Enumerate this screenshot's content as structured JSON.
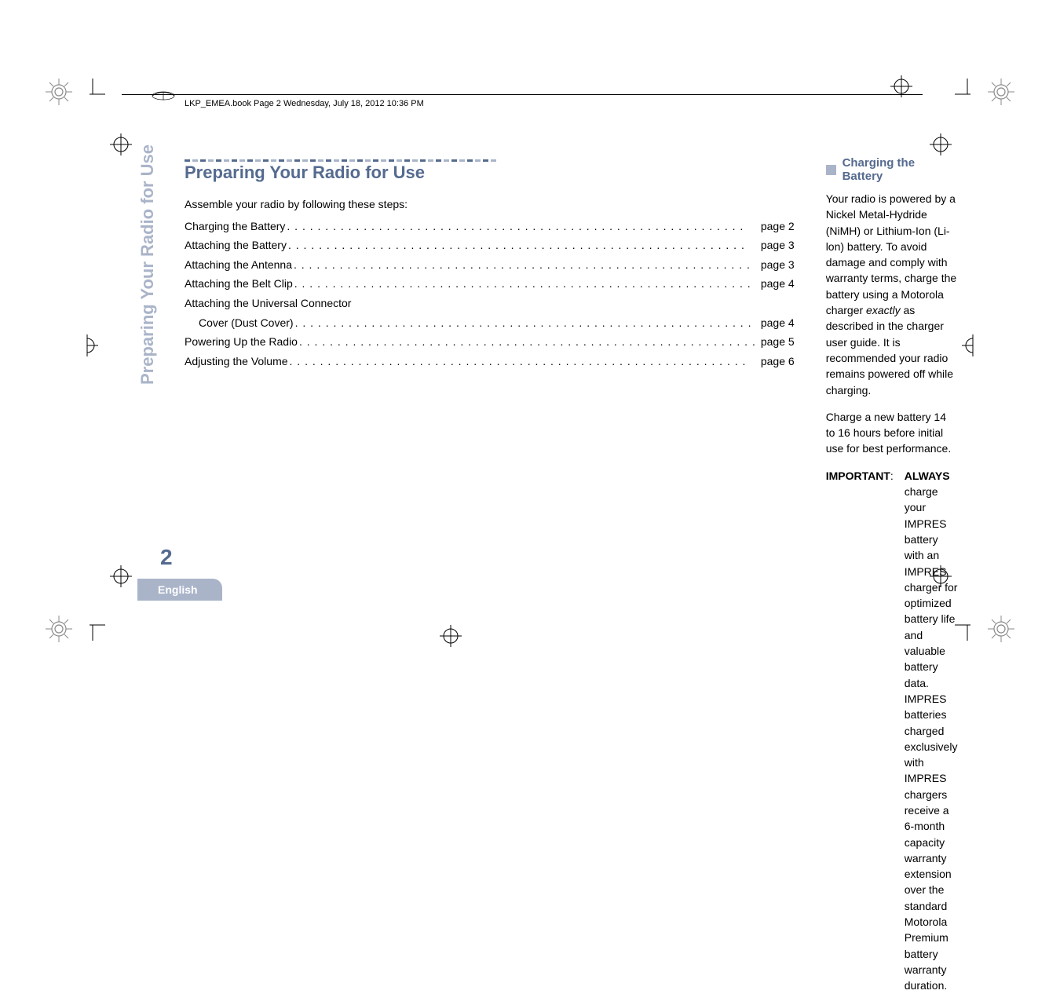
{
  "header": {
    "line": "LKP_EMEA.book  Page 2  Wednesday, July 18, 2012  10:36 PM"
  },
  "side_title": "Preparing Your Radio for Use",
  "page_number": "2",
  "language": "English",
  "left": {
    "title": "Preparing Your Radio for Use",
    "intro": "Assemble your radio by following these steps:",
    "toc": [
      {
        "label": "Charging the Battery",
        "page": "page 2",
        "sub": false,
        "wrap": false
      },
      {
        "label": "Attaching the Battery",
        "page": "page 3",
        "sub": false,
        "wrap": false
      },
      {
        "label": "Attaching the Antenna",
        "page": "page 3",
        "sub": false,
        "wrap": false
      },
      {
        "label": "Attaching the Belt Clip",
        "page": "page 4",
        "sub": false,
        "wrap": false
      },
      {
        "label": "Attaching the Universal Connector ",
        "page": "",
        "sub": false,
        "wrap": true
      },
      {
        "label": "Cover (Dust Cover)",
        "page": "page 4",
        "sub": true,
        "wrap": false
      },
      {
        "label": "Powering Up the Radio",
        "page": "page 5",
        "sub": false,
        "wrap": false
      },
      {
        "label": "Adjusting the Volume ",
        "page": "page 6",
        "sub": false,
        "wrap": false
      }
    ]
  },
  "right": {
    "subheading": "Charging the Battery",
    "para1_pre": "Your radio is powered by a Nickel Metal-Hydride (NiMH) or Lithium-Ion (Li-lon) battery. To avoid damage and comply with warranty terms, charge the battery using a Motorola charger ",
    "para1_em": "exactly",
    "para1_post": " as described in the charger user guide. It is recommended your radio remains powered off while charging.",
    "para2": "Charge a new battery 14 to 16 hours before initial use for best performance.",
    "important_label": "IMPORTANT",
    "important_colon": ":",
    "important_always": "ALWAYS",
    "important_text": " charge your IMPRES battery with an IMPRES charger for optimized battery life and valuable battery data. IMPRES batteries charged exclusively with IMPRES chargers receive a 6-month capacity warranty extension over the standard Motorola Premium battery warranty duration."
  }
}
